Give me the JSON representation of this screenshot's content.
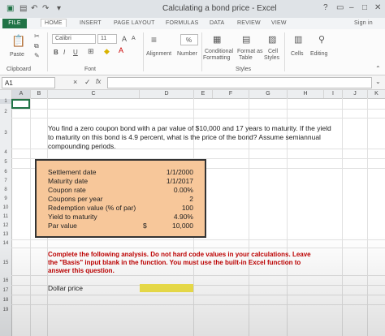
{
  "window": {
    "title": "Calculating a bond price - Excel",
    "help": "?",
    "sign_in": "Sign in"
  },
  "tabs": [
    "FILE",
    "HOME",
    "INSERT",
    "PAGE LAYOUT",
    "FORMULAS",
    "DATA",
    "REVIEW",
    "VIEW"
  ],
  "ribbon": {
    "paste": "Paste",
    "clipboard": "Clipboard",
    "font_name": "Calibri",
    "font_size": "11",
    "font_grow": "A",
    "font_shrink": "A",
    "bold": "B",
    "italic": "I",
    "underline": "U",
    "font_group": "Font",
    "alignment": "Alignment",
    "number": "Number",
    "percent": "%",
    "conditional": "Conditional",
    "formatting": "Formatting",
    "format_as": "Format as",
    "table": "Table",
    "cell": "Cell",
    "styles_btn": "Styles",
    "cells": "Cells",
    "editing": "Editing",
    "styles_group": "Styles"
  },
  "formula_bar": {
    "name_box": "A1",
    "cancel": "×",
    "enter": "✓",
    "fx": "fx",
    "content": ""
  },
  "columns": [
    "A",
    "B",
    "C",
    "D",
    "E",
    "F",
    "G",
    "H",
    "I",
    "J",
    "K"
  ],
  "rows": [
    "1",
    "2",
    "3",
    "4",
    "5",
    "6",
    "7",
    "8",
    "9",
    "10",
    "11",
    "12",
    "13",
    "14",
    "15",
    "16",
    "17",
    "18",
    "19"
  ],
  "question": [
    "You find a zero coupon bond with a par value of $10,000 and 17 years to maturity. If the yield",
    "to maturity on this bond is 4.9 percent, what is the price of the bond? Assume semiannual",
    "compounding periods."
  ],
  "inputs": [
    {
      "label": "Settlement date",
      "value": "1/1/2000"
    },
    {
      "label": "Maturity date",
      "value": "1/1/2017"
    },
    {
      "label": "Coupon rate",
      "value": "0.00%"
    },
    {
      "label": "Coupons per year",
      "value": "2"
    },
    {
      "label": "Redemption value (% of par)",
      "value": "100"
    },
    {
      "label": "Yield to maturity",
      "value": "4.90%"
    },
    {
      "label": "Par value",
      "currency": "$",
      "value": "10,000"
    }
  ],
  "instructions": [
    "Complete the following analysis. Do not hard code values in your calculations. Leave",
    "the \"Basis\" input blank in the function. You must use the built-in Excel function to",
    "answer this question."
  ],
  "answer": {
    "label": "Dollar price",
    "value": ""
  },
  "colors": {
    "excel_green": "#217346",
    "input_fill": "#f7c79a",
    "answer_fill": "#f4e64c",
    "instruction_red": "#c00000"
  }
}
